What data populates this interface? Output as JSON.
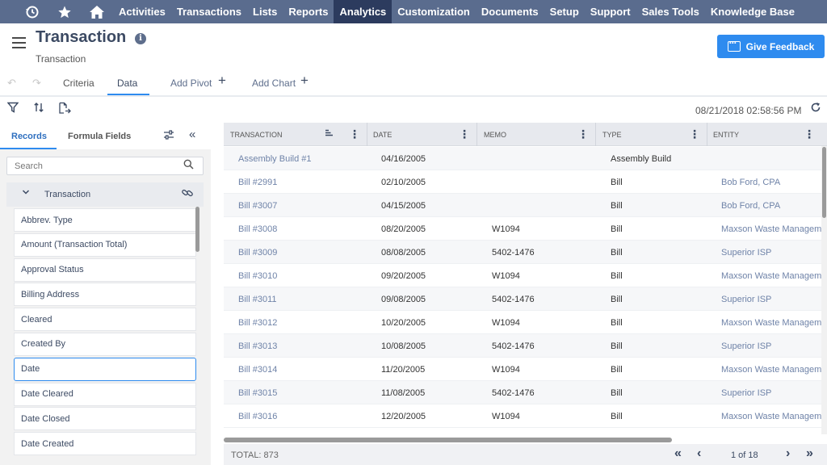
{
  "nav": {
    "icons": [
      "history-icon",
      "star-icon",
      "home-icon"
    ],
    "items": [
      "Activities",
      "Transactions",
      "Lists",
      "Reports",
      "Analytics",
      "Customization",
      "Documents",
      "Setup",
      "Support",
      "Sales Tools",
      "Knowledge Base"
    ],
    "active": "Analytics"
  },
  "header": {
    "title": "Transaction",
    "subtitle": "Transaction",
    "feedback_label": "Give Feedback"
  },
  "tabs": {
    "criteria": "Criteria",
    "data": "Data",
    "add_pivot": "Add Pivot",
    "add_chart": "Add Chart"
  },
  "toolbar": {
    "timestamp": "08/21/2018 02:58:56 PM"
  },
  "left_panel": {
    "tab_records": "Records",
    "tab_formula": "Formula Fields",
    "search_placeholder": "Search",
    "group_label": "Transaction",
    "items": [
      "Abbrev. Type",
      "Amount (Transaction Total)",
      "Approval Status",
      "Billing Address",
      "Cleared",
      "Created By",
      "Date",
      "Date Cleared",
      "Date Closed",
      "Date Created"
    ],
    "selected": "Date"
  },
  "grid": {
    "columns": [
      "TRANSACTION",
      "DATE",
      "MEMO",
      "TYPE",
      "ENTITY"
    ],
    "rows": [
      [
        "Assembly Build #1",
        "04/16/2005",
        "",
        "Assembly Build",
        ""
      ],
      [
        "Bill #2991",
        "02/10/2005",
        "",
        "Bill",
        "Bob Ford, CPA"
      ],
      [
        "Bill #3007",
        "04/15/2005",
        "",
        "Bill",
        "Bob Ford, CPA"
      ],
      [
        "Bill #3008",
        "08/20/2005",
        "W1094",
        "Bill",
        "Maxson Waste Management"
      ],
      [
        "Bill #3009",
        "08/08/2005",
        "5402-1476",
        "Bill",
        "Superior ISP"
      ],
      [
        "Bill #3010",
        "09/20/2005",
        "W1094",
        "Bill",
        "Maxson Waste Management"
      ],
      [
        "Bill #3011",
        "09/08/2005",
        "5402-1476",
        "Bill",
        "Superior ISP"
      ],
      [
        "Bill #3012",
        "10/20/2005",
        "W1094",
        "Bill",
        "Maxson Waste Management"
      ],
      [
        "Bill #3013",
        "10/08/2005",
        "5402-1476",
        "Bill",
        "Superior ISP"
      ],
      [
        "Bill #3014",
        "11/20/2005",
        "W1094",
        "Bill",
        "Maxson Waste Management"
      ],
      [
        "Bill #3015",
        "11/08/2005",
        "5402-1476",
        "Bill",
        "Superior ISP"
      ],
      [
        "Bill #3016",
        "12/20/2005",
        "W1094",
        "Bill",
        "Maxson Waste Management"
      ]
    ],
    "total": "TOTAL: 873",
    "page_label": "1 of 18"
  },
  "colors": {
    "nav_bg": "#5a6c8e",
    "nav_active": "#2c3b5e",
    "accent": "#2e8bef",
    "link": "#6f83a8"
  }
}
